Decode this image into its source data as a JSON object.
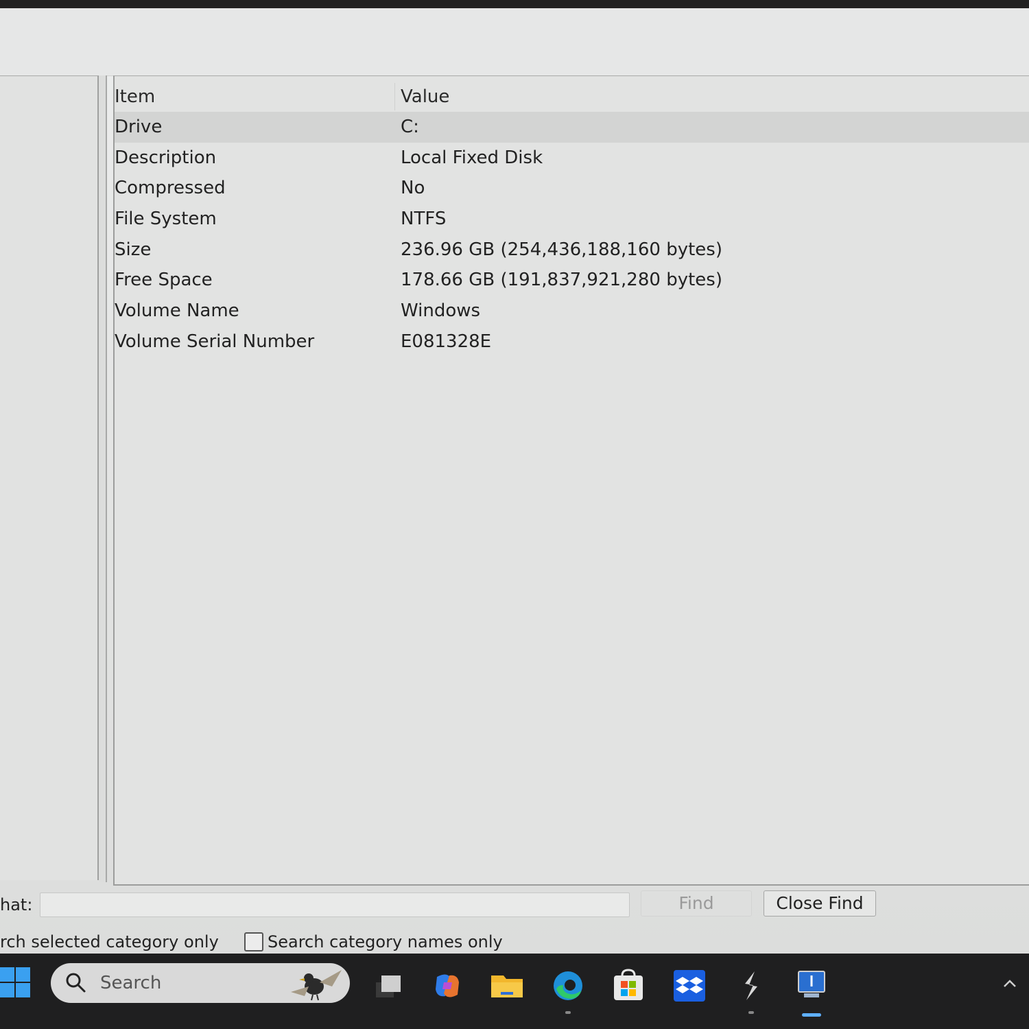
{
  "list": {
    "columns": {
      "item": "Item",
      "value": "Value"
    },
    "rows": [
      {
        "item": "Drive",
        "value": "C:"
      },
      {
        "item": "Description",
        "value": "Local Fixed Disk"
      },
      {
        "item": "Compressed",
        "value": "No"
      },
      {
        "item": "File System",
        "value": "NTFS"
      },
      {
        "item": "Size",
        "value": "236.96 GB (254,436,188,160 bytes)"
      },
      {
        "item": "Free Space",
        "value": "178.66 GB (191,837,921,280 bytes)"
      },
      {
        "item": "Volume Name",
        "value": "Windows"
      },
      {
        "item": "Volume Serial Number",
        "value": "E081328E"
      }
    ],
    "selected_row": "Drive"
  },
  "find": {
    "label": "hat:",
    "input_value": "",
    "find_button": "Find",
    "close_find_button": "Close Find",
    "search_selected_label": "rch selected category only",
    "search_names_label": "Search category names only",
    "search_names_checked": false
  },
  "taskbar": {
    "search_placeholder": "Search",
    "icons": [
      "windows-start-icon",
      "search-icon",
      "task-view-icon",
      "copilot-icon",
      "file-explorer-icon",
      "edge-icon",
      "microsoft-store-icon",
      "dropbox-icon",
      "app-s-icon",
      "system-information-icon",
      "show-hidden-icons-chevron"
    ],
    "accent": "#3aa0f0"
  }
}
